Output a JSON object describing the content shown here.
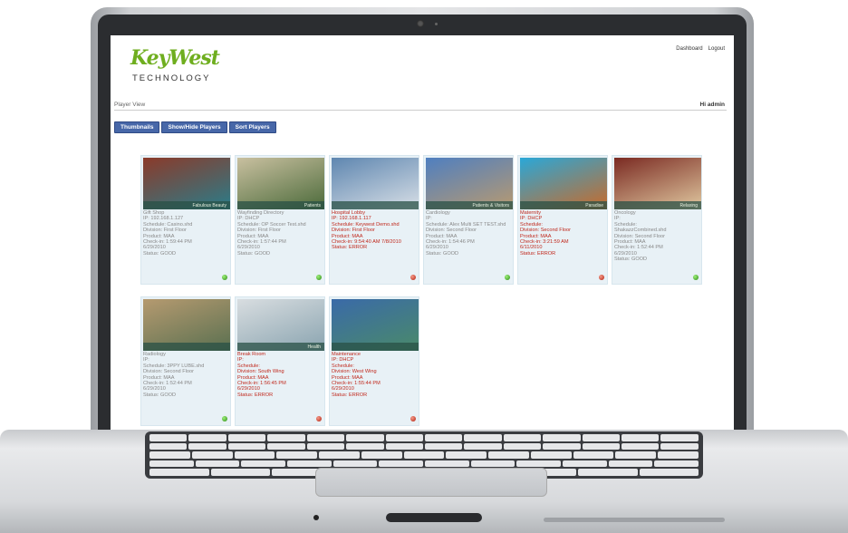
{
  "app": {
    "logo_text": "KeyWest",
    "logo_sub": "TECHNOLOGY",
    "links": [
      "Dashboard",
      "Logout"
    ],
    "page_title": "Player View",
    "user": "Hi admin",
    "tabs": [
      "Thumbnails",
      "Show/Hide Players",
      "Sort Players"
    ]
  },
  "players": [
    {
      "name": "Gift Shop",
      "lines": "Gift Shop\nIP: 192.168.1.127\nSchedule: Casino.shd\nDivision: First Floor\nProduct: MAA\nCheck-in: 1:59:44 PM\n6/29/2010\nStatus: GOOD",
      "status": "ok",
      "band": "Fabulous Beauty",
      "colors": [
        "#8b3a2a",
        "#2a7d8a"
      ]
    },
    {
      "name": "Wayfinding Directory",
      "lines": "Wayfinding Directory\nIP: DHCP\nSchedule: OP Soccer Test.shd\nDivision: First Floor\nProduct: MAA\nCheck-in: 1:57:44 PM\n6/29/2010\nStatus: GOOD",
      "status": "ok",
      "band": "Patients",
      "colors": [
        "#c9c0a0",
        "#4b6a3a"
      ]
    },
    {
      "name": "Hospital Lobby",
      "lines": "Hospital Lobby\nIP: 192.168.1.117\nSchedule: Keywest Demo.shd\nDivision: First Floor\nProduct: MAA\nCheck-in: 9:54:40 AM 7/8/2010\nStatus: ERROR",
      "status": "bad",
      "band": "",
      "colors": [
        "#5e86b0",
        "#d8dfe6"
      ]
    },
    {
      "name": "Cardiology",
      "lines": "Cardiology\nIP:\nSchedule: Alex Multi SET TEST.shd\nDivision: Second Floor\nProduct: MAA\nCheck-in: 1:54:46 PM\n6/29/2010\nStatus: GOOD",
      "status": "ok",
      "band": "Patients & Visitors",
      "colors": [
        "#4f7fc0",
        "#b89a70"
      ]
    },
    {
      "name": "Maternity",
      "lines": "Maternity\nIP: DHCP\nSchedule:\nDivision: Second Floor\nProduct: MAA\nCheck-in: 3:21:59 AM\n6/11/2010\nStatus: ERROR",
      "status": "bad",
      "band": "Paradise",
      "colors": [
        "#2aa8d8",
        "#c86a2a"
      ]
    },
    {
      "name": "Oncology",
      "lines": "Oncology\nIP:\nSchedule:\nShakazzCombined.shd\nDivision: Second Floor\nProduct: MAA\nCheck-in: 1:52:44 PM\n6/29/2010\nStatus: GOOD",
      "status": "ok",
      "band": "Relaxing",
      "colors": [
        "#7a2a22",
        "#e0c8a0"
      ]
    },
    {
      "name": "Radiology",
      "lines": "Radiology\nIP:\nSchedule: 3PPY LUBE.shd\nDivision: Second Floor\nProduct: MAA\nCheck-in: 1:52:44 PM\n6/29/2010\nStatus: GOOD",
      "status": "ok",
      "band": "",
      "colors": [
        "#b59a70",
        "#5a7050"
      ]
    },
    {
      "name": "Break Room",
      "lines": "Break Room\nIP:\nSchedule:\nDivision: South Wing\nProduct: MAA\nCheck-in: 1:56:45 PM\n6/29/2010\nStatus: ERROR",
      "status": "bad",
      "band": "Health",
      "colors": [
        "#d8dde0",
        "#8aa4b0"
      ]
    },
    {
      "name": "Maintenance",
      "lines": "Maintenance\nIP: DHCP\nSchedule:\nDivision: West Wing\nProduct: MAA\nCheck-in: 1:55:44 PM\n6/29/2010\nStatus: ERROR",
      "status": "bad",
      "band": "",
      "colors": [
        "#3a6aa8",
        "#4a8a6a"
      ]
    }
  ]
}
